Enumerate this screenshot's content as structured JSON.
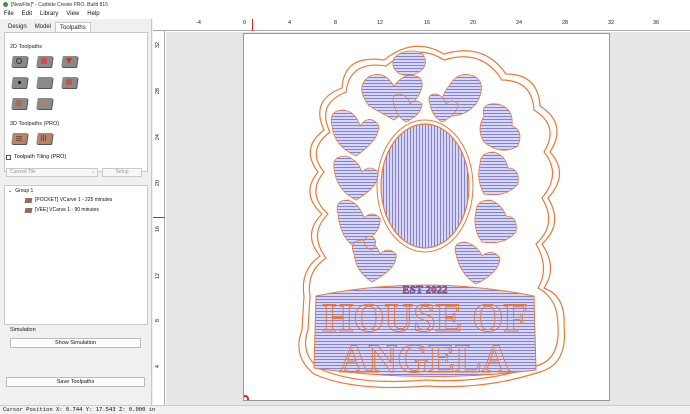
{
  "window": {
    "title": "[NewFile]* - Carbide Create PRO, Build 815"
  },
  "menu": [
    "File",
    "Edit",
    "Library",
    "View",
    "Help"
  ],
  "tabs": [
    "Design",
    "Model",
    "Toolpaths"
  ],
  "sections": {
    "toolpaths_2d": "2D Toolpaths",
    "toolpaths_3d": "3D Toolpaths (PRO)",
    "tiling": "Toolpath Tiling (PRO)",
    "current_tile": "Current Tile",
    "setup": "Setup"
  },
  "tree": {
    "group": "Group 1",
    "items": [
      "[POCKET] VCarve 1 - 225 minutes",
      "[VEE] VCarve 1 - 90 minutes"
    ]
  },
  "simulation": {
    "label": "Simulation",
    "show_button": "Show Simulation",
    "save_button": "Save Toolpaths"
  },
  "ruler": {
    "top": [
      "-4",
      "0",
      "4",
      "8",
      "12",
      "16",
      "20",
      "24",
      "28",
      "32",
      "36"
    ],
    "left": [
      "32",
      "28",
      "24",
      "20",
      "16",
      "12",
      "8",
      "4"
    ]
  },
  "design_text": {
    "est": "EST 2022",
    "line1": "HOUSE OF",
    "line2": "ANGELA"
  },
  "status": "Cursor Position X: 0.744 Y: 17.543 Z: 0.000 in",
  "colors": {
    "toolpath_blue": "#3b3bd0",
    "toolpath_orange": "#e87b3a",
    "accent_red": "#e02020"
  }
}
